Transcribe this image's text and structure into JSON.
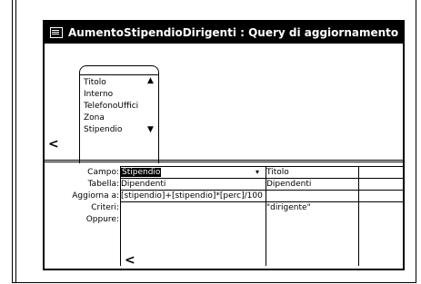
{
  "window": {
    "title": "AumentoStipendioDirigenti : Query di aggiornamento"
  },
  "table_box": {
    "fields": [
      "Titolo",
      "Interno",
      "TelefonoUffici",
      "Zona",
      "Stipendio"
    ]
  },
  "grid": {
    "row_labels": [
      "Campo:",
      "Tabella:",
      "Aggiorna a:",
      "Criteri:",
      "Oppure:"
    ],
    "columns": [
      {
        "campo": "Stipendio",
        "tabella": "Dipendenti",
        "aggiorna_a": "[stipendio]+[stipendio]*[perc]/100",
        "criteri": ""
      },
      {
        "campo": "Titolo",
        "tabella": "Dipendenti",
        "aggiorna_a": "",
        "criteri": "\"dirigente\""
      }
    ]
  }
}
